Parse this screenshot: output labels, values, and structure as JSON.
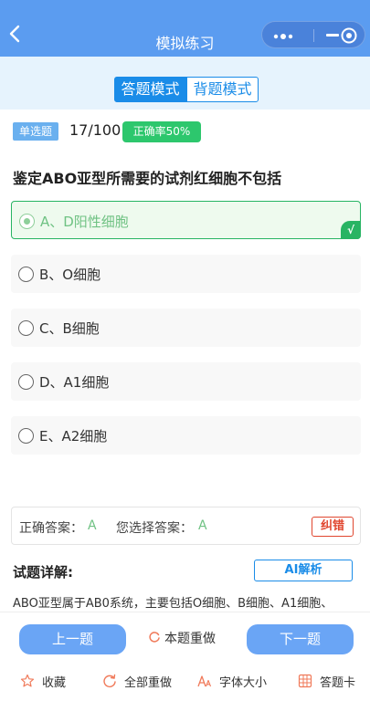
{
  "navbar": {
    "title": "模拟练习",
    "back_icon": "chevron-left-icon",
    "capsule_icons": [
      "more-dots-icon",
      "minimize-icon",
      "close-target-icon"
    ]
  },
  "mode_tabs": {
    "active": "答题模式",
    "inactive": "背题模式"
  },
  "question_header": {
    "type_badge": "单选题",
    "progress": "17/100",
    "accuracy": "正确率50%"
  },
  "question": {
    "text": "鉴定ABO亚型所需要的试剂红细胞不包括",
    "options": [
      {
        "label": "A、D阳性细胞",
        "state": "correct"
      },
      {
        "label": "B、O细胞",
        "state": "normal"
      },
      {
        "label": "C、B细胞",
        "state": "normal"
      },
      {
        "label": "D、A1细胞",
        "state": "normal"
      },
      {
        "label": "E、A2细胞",
        "state": "normal"
      }
    ],
    "correct_mark": "√"
  },
  "answer": {
    "correct_label": "正确答案：",
    "correct_value": "A",
    "selected_label": "您选择答案：",
    "selected_value": "A",
    "fix_button": "纠错"
  },
  "detail": {
    "title": "试题详解:",
    "ai_button": "AI解析",
    "text": "ABO亚型属于AB0系统，主要包括O细胞、B细胞、A1细胞、"
  },
  "bottom": {
    "prev": "上一题",
    "redo": "本题重做",
    "next": "下一题",
    "tools": [
      {
        "label": "收藏",
        "icon": "star-icon"
      },
      {
        "label": "全部重做",
        "icon": "refresh-icon"
      },
      {
        "label": "字体大小",
        "icon": "font-size-icon"
      },
      {
        "label": "答题卡",
        "icon": "answer-card-icon"
      }
    ]
  },
  "colors": {
    "nav_bg": "#5b9cf0",
    "accent": "#1a8ce8",
    "correct": "#28b463",
    "error": "#e0462f",
    "tool_icon": "#f07a5a"
  }
}
